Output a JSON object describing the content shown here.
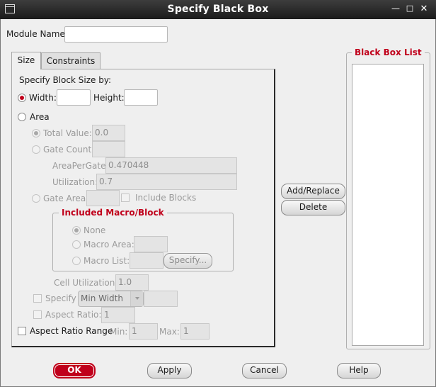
{
  "window": {
    "title": "Specify Black Box"
  },
  "module": {
    "label": "Module Name:",
    "value": ""
  },
  "tabs": [
    {
      "label": "Size"
    },
    {
      "label": "Constraints"
    }
  ],
  "size": {
    "specify_label": "Specify Block Size by:",
    "width_label": "Width:",
    "width_value": "",
    "height_label": "Height:",
    "height_value": "",
    "area_label": "Area",
    "total_value_label": "Total Value:",
    "total_value": "0.0",
    "gate_count_label": "Gate Count:",
    "gate_count_value": "",
    "area_per_gate_label": "AreaPerGate:",
    "area_per_gate_value": "0.470448",
    "utilization_label": "Utilization:",
    "utilization_value": "0.7",
    "gate_area_label": "Gate Area:",
    "gate_area_value": "",
    "include_blocks_label": "Include Blocks",
    "macro_group_title": "Included Macro/Block",
    "none_label": "None",
    "macro_area_label": "Macro Area:",
    "macro_area_value": "",
    "macro_list_label": "Macro List:",
    "macro_list_value": "",
    "specify_button": "Specify...",
    "cell_util_label": "Cell Utilization:",
    "cell_util_value": "1.0",
    "specify_check_label": "Specify",
    "specify_combo_value": "Min Width",
    "specify_combo_field": "",
    "aspect_ratio_label": "Aspect Ratio:",
    "aspect_ratio_value": "1",
    "aspect_range_label": "Aspect Ratio Range",
    "min_label": "Min:",
    "min_value": "1",
    "max_label": "Max:",
    "max_value": "1"
  },
  "actions": {
    "add_replace": "Add/Replace",
    "delete": "Delete"
  },
  "blackbox_list": {
    "title": "Black Box List",
    "items": []
  },
  "footer": {
    "ok": "OK",
    "apply": "Apply",
    "cancel": "Cancel",
    "help": "Help"
  },
  "colors": {
    "accent": "#c0001b",
    "titlebar": "#1b1b1b",
    "background": "#efefef"
  }
}
